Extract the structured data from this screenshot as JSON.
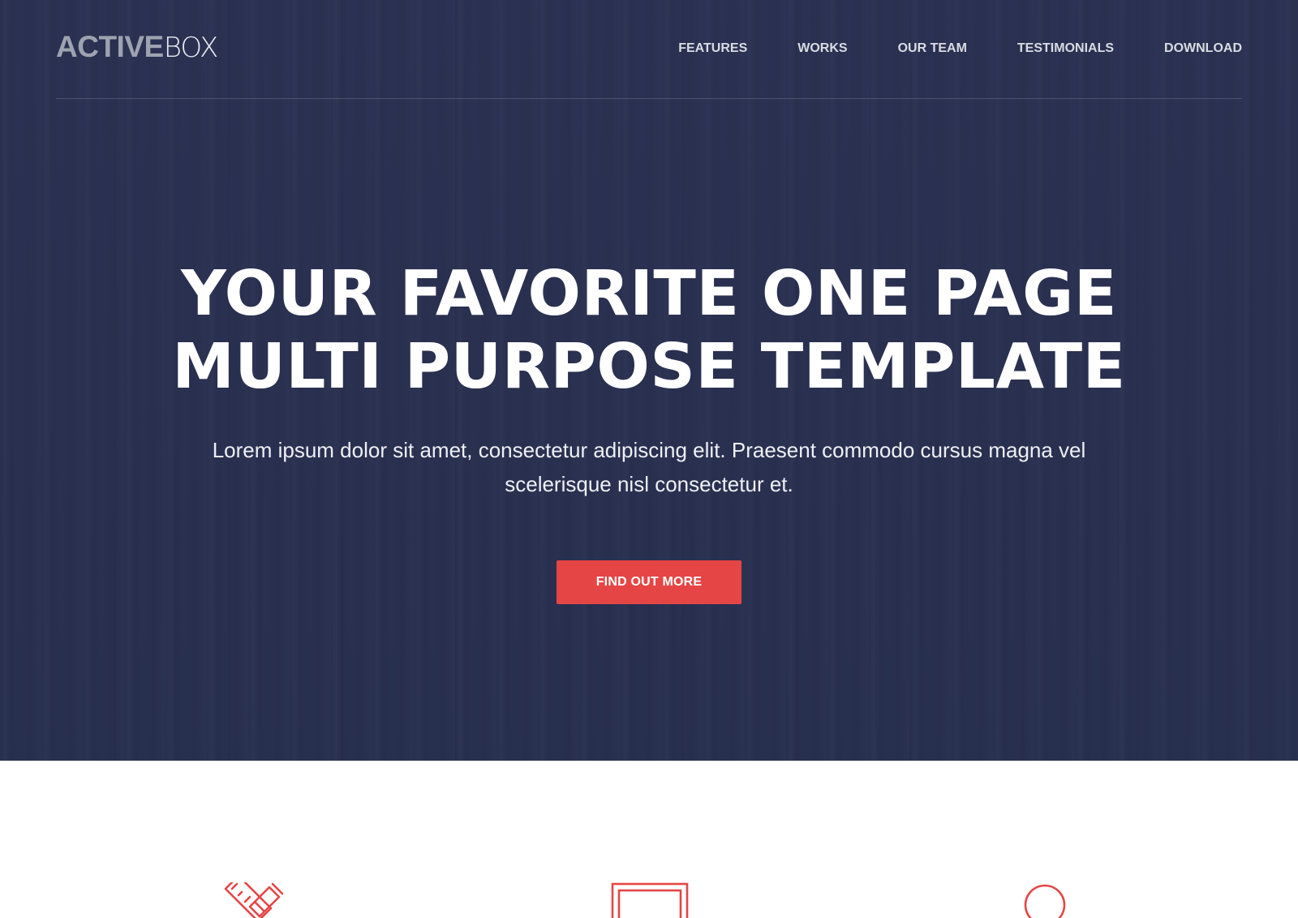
{
  "header": {
    "logo": {
      "bold": "ACTIVE",
      "light": "BOX"
    },
    "nav": [
      {
        "label": "FEATURES"
      },
      {
        "label": "WORKS"
      },
      {
        "label": "OUR TEAM"
      },
      {
        "label": "TESTIMONIALS"
      },
      {
        "label": "DOWNLOAD"
      }
    ]
  },
  "hero": {
    "title_line1": "YOUR FAVORITE ONE PAGE",
    "title_line2": "MULTI PURPOSE TEMPLATE",
    "subtitle_line1": "Lorem ipsum dolor sit amet, consectetur adipiscing elit. Praesent commodo cursus magna vel",
    "subtitle_line2": "scelerisque nisl consectetur et.",
    "cta_label": "FIND OUT MORE"
  },
  "features": {
    "icons": [
      "pencil-ruler-icon",
      "frame-icon",
      "circle-icon"
    ]
  },
  "colors": {
    "hero_background": "#2a3050",
    "accent": "#e64545",
    "logo_bold": "#9ea3b0",
    "nav_text": "#d9dce3"
  }
}
